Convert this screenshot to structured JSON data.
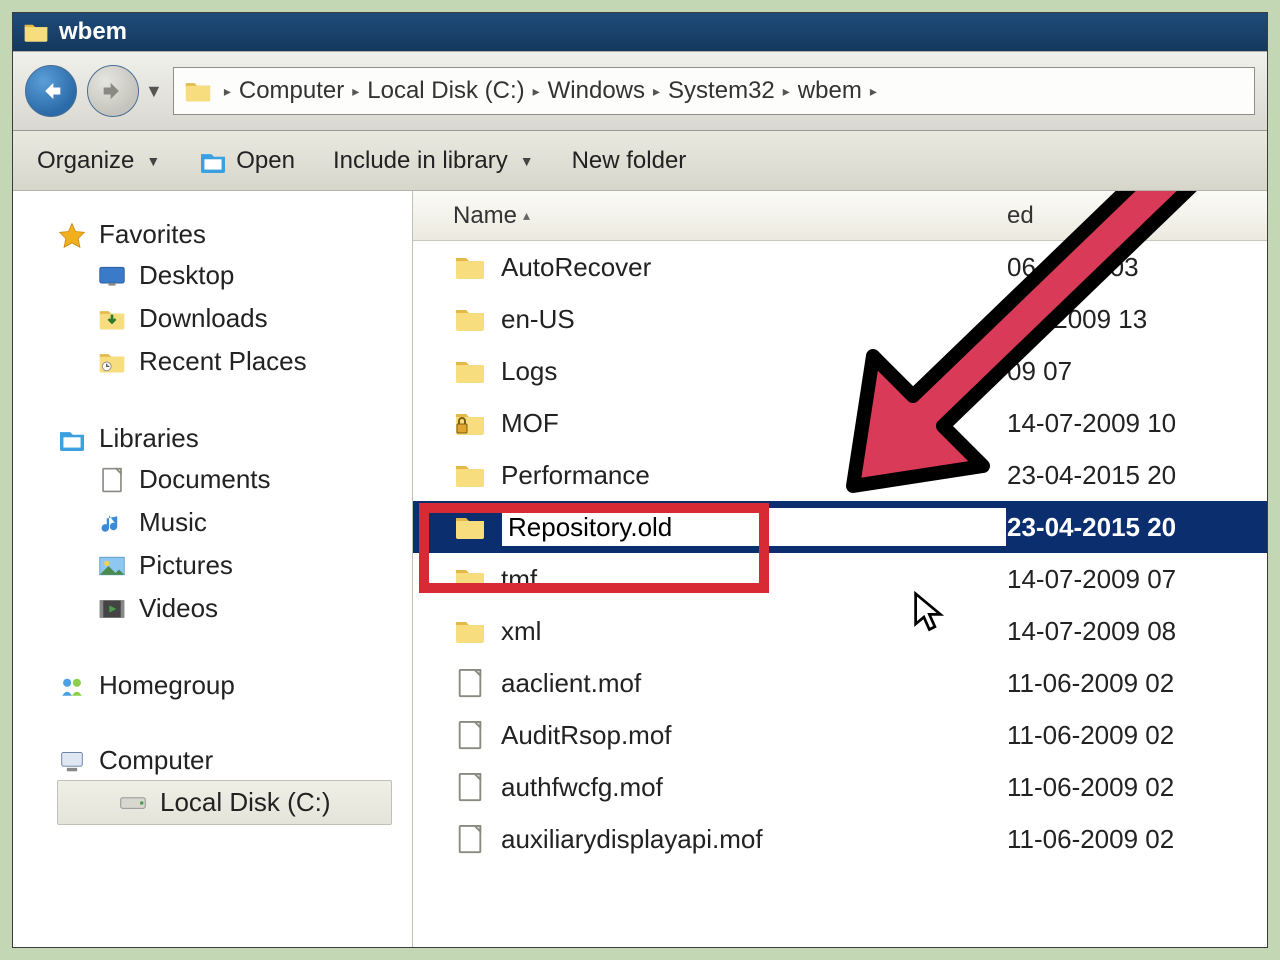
{
  "window": {
    "title": "wbem"
  },
  "breadcrumb": {
    "segments": [
      "Computer",
      "Local Disk (C:)",
      "Windows",
      "System32",
      "wbem"
    ]
  },
  "toolbar": {
    "organize": "Organize",
    "open": "Open",
    "include": "Include in library",
    "newfolder": "New folder"
  },
  "nav": {
    "favorites": {
      "label": "Favorites",
      "items": [
        "Desktop",
        "Downloads",
        "Recent Places"
      ]
    },
    "libraries": {
      "label": "Libraries",
      "items": [
        "Documents",
        "Music",
        "Pictures",
        "Videos"
      ]
    },
    "homegroup": {
      "label": "Homegroup"
    },
    "computer": {
      "label": "Computer",
      "items": [
        "Local Disk (C:)"
      ]
    }
  },
  "columns": {
    "name": "Name",
    "date": "Date modified",
    "date_partial": "ed"
  },
  "files": [
    {
      "name": "AutoRecover",
      "type": "folder",
      "date": "06-2013 03"
    },
    {
      "name": "en-US",
      "type": "folder",
      "date": "-07-2009 13"
    },
    {
      "name": "Logs",
      "type": "folder",
      "date": "09 07"
    },
    {
      "name": "MOF",
      "type": "folder-locked",
      "date": "14-07-2009 10"
    },
    {
      "name": "Performance",
      "type": "folder",
      "date": "23-04-2015 20"
    },
    {
      "name": "Repository.old",
      "type": "folder",
      "date": "23-04-2015 20",
      "selected": true,
      "renaming": true
    },
    {
      "name": "tmf",
      "type": "folder",
      "date": "14-07-2009 07"
    },
    {
      "name": "xml",
      "type": "folder",
      "date": "14-07-2009 08"
    },
    {
      "name": "aaclient.mof",
      "type": "file",
      "date": "11-06-2009 02"
    },
    {
      "name": "AuditRsop.mof",
      "type": "file",
      "date": "11-06-2009 02"
    },
    {
      "name": "authfwcfg.mof",
      "type": "file",
      "date": "11-06-2009 02"
    },
    {
      "name": "auxiliarydisplayapi.mof",
      "type": "file",
      "date": "11-06-2009 02"
    }
  ],
  "annotation": {
    "arrow_color": "#d83a57",
    "highlight_color": "#d82a34"
  }
}
